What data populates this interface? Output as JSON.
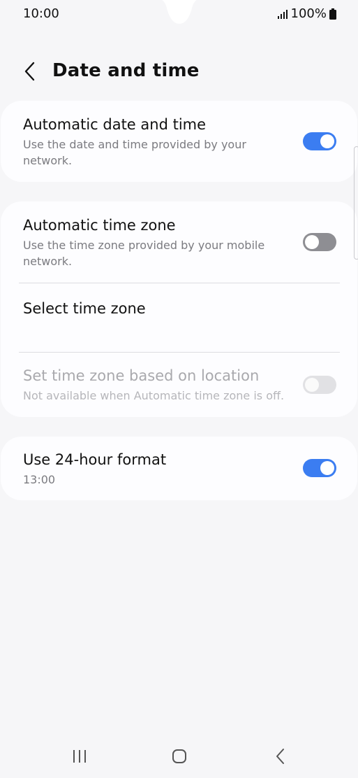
{
  "status_bar": {
    "time": "10:00",
    "battery": "100%"
  },
  "header": {
    "title": "Date and time"
  },
  "settings": {
    "auto_datetime": {
      "title": "Automatic date and time",
      "subtitle": "Use the date and time provided by your network.",
      "enabled": true
    },
    "auto_timezone": {
      "title": "Automatic time zone",
      "subtitle": "Use the time zone provided by your mobile network.",
      "enabled": false
    },
    "select_timezone": {
      "title": "Select time zone"
    },
    "location_timezone": {
      "title": "Set time zone based on location",
      "subtitle": "Not available when Automatic time zone is off.",
      "enabled": false,
      "available": false
    },
    "hour_format": {
      "title": "Use 24-hour format",
      "subtitle": "13:00",
      "enabled": true
    }
  },
  "colors": {
    "accent": "#3b7df1",
    "background": "#f6f6f8",
    "card": "#fdfdff"
  },
  "icons": {
    "back": "chevron-left-icon",
    "signal": "signal-icon",
    "battery": "battery-icon",
    "recents": "recents-icon",
    "home": "home-icon",
    "nav_back": "back-icon"
  }
}
